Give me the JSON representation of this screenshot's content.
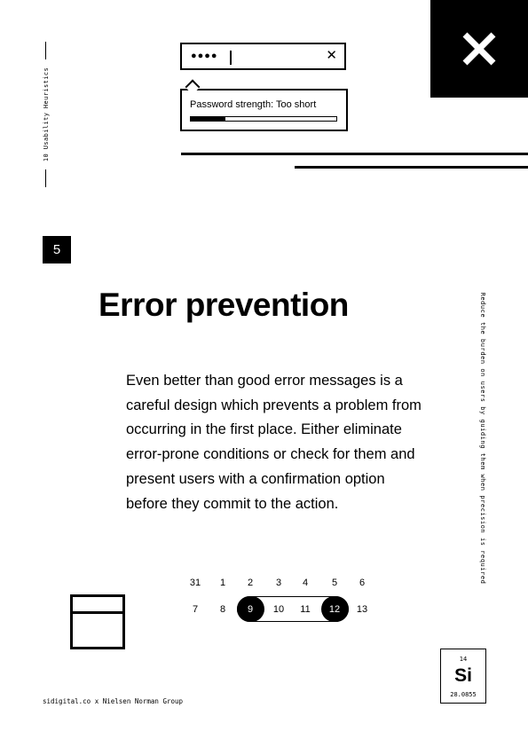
{
  "side_label": "10 Usability Heuristics",
  "password": {
    "masked_value": "●●●●",
    "clear_glyph": "✕",
    "strength_text": "Password strength: Too short",
    "strength_fraction": 0.24
  },
  "close_glyph": "✕",
  "heuristic_number": "5",
  "title": "Error prevention",
  "body": "Even better than good error messages is a careful design which prevents a problem from occurring in the first place. Either eliminate error-prone conditions or check for them and present users with a confirmation option before they commit to the action.",
  "tagline": "Reduce the burden on users by guiding them when precision is required",
  "calendar": {
    "row1": [
      "31",
      "1",
      "2",
      "3",
      "4",
      "5",
      "6"
    ],
    "row2": [
      "7",
      "8",
      "9",
      "10",
      "11",
      "12",
      "13"
    ],
    "range_start": "9",
    "range_end": "12"
  },
  "icons": [
    "close-icon",
    "clear-icon",
    "window-icon"
  ],
  "footer": "sidigital.co x Nielsen Norman Group",
  "element": {
    "number": "14",
    "symbol": "Si",
    "mass": "28.0855"
  }
}
